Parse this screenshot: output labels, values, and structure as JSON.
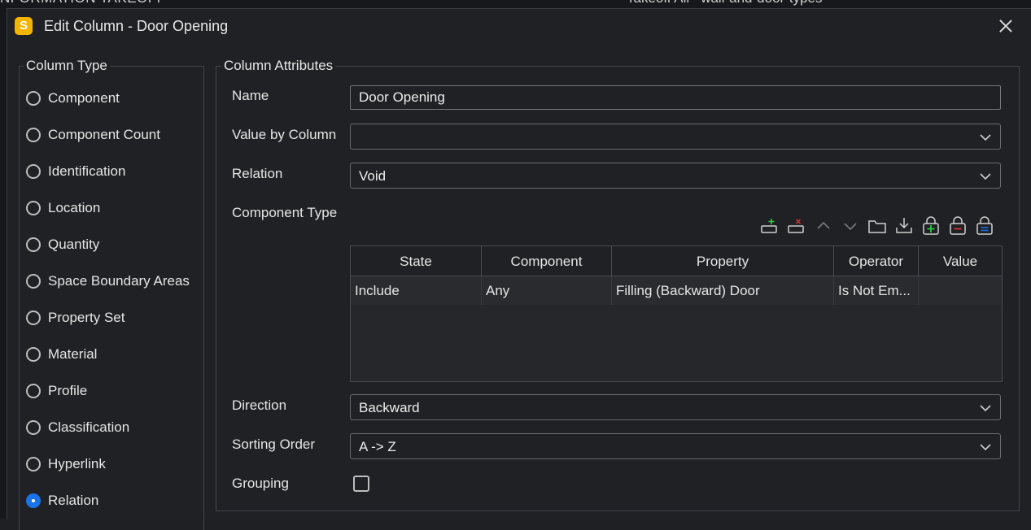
{
  "background": {
    "title": "NFORMATION TAKEOFF",
    "takeoff_button": "Takeoff All",
    "type_select": "wall-and-door-types"
  },
  "dialog": {
    "title": "Edit Column - Door Opening",
    "app_logo": "S",
    "close_icon": "close-icon"
  },
  "column_type": {
    "title": "Column Type",
    "selected": "Relation",
    "options": [
      "Component",
      "Component Count",
      "Identification",
      "Location",
      "Quantity",
      "Space Boundary Areas",
      "Property Set",
      "Material",
      "Profile",
      "Classification",
      "Hyperlink",
      "Relation"
    ]
  },
  "column_attributes": {
    "title": "Column Attributes",
    "name_label": "Name",
    "name_value": "Door Opening",
    "value_by_column_label": "Value by Column",
    "value_by_column_value": "",
    "relation_label": "Relation",
    "relation_value": "Void",
    "component_type_label": "Component Type",
    "toolbar_icons": [
      "add-row-icon",
      "remove-row-icon",
      "move-up-icon",
      "move-down-icon",
      "open-folder-icon",
      "import-icon",
      "add-locked-icon",
      "remove-locked-icon",
      "lock-equals-icon"
    ],
    "table": {
      "columns": [
        "State",
        "Component",
        "Property",
        "Operator",
        "Value"
      ],
      "rows": [
        [
          "Include",
          "Any",
          "Filling (Backward) Door",
          "Is Not Em...",
          ""
        ]
      ]
    },
    "direction_label": "Direction",
    "direction_value": "Backward",
    "sorting_order_label": "Sorting Order",
    "sorting_order_value": "A -> Z",
    "grouping_label": "Grouping",
    "grouping_checked": false
  },
  "colors": {
    "accent": "#1a73e8",
    "logo": "#f4b400",
    "background": "#202125",
    "add": "#2ecc40",
    "remove": "#e0322f"
  }
}
